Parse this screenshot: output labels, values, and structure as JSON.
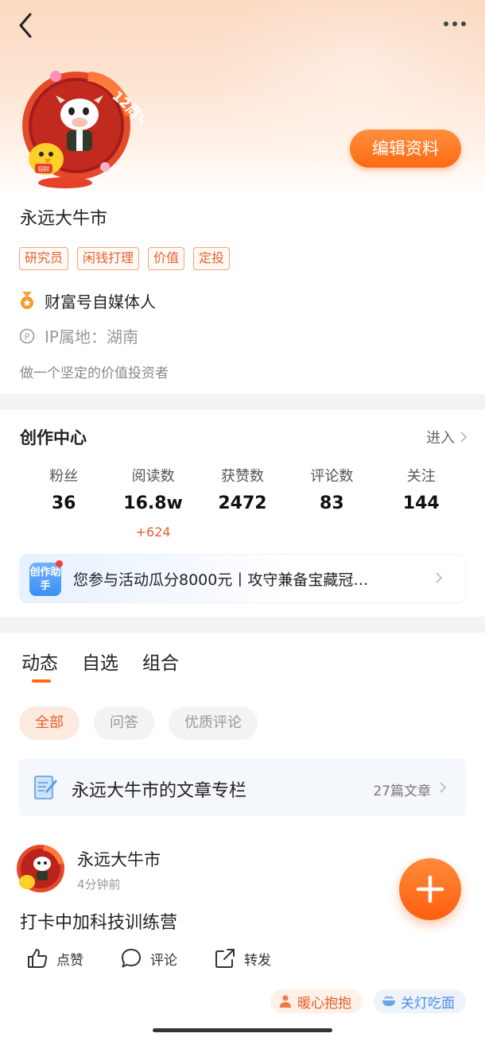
{
  "header": {
    "back_icon": "chevron-left-icon",
    "more_icon": "more-dots-icon"
  },
  "profile": {
    "avatar_badge": "12周年庆",
    "edit_label": "编辑资料",
    "name": "永远大牛市",
    "tags": [
      "研究员",
      "闲钱打理",
      "价值",
      "定投"
    ],
    "badge_text": "财富号自媒体人",
    "ip_text": "IP属地：湖南",
    "bio": "做一个坚定的价值投资者"
  },
  "creator_center": {
    "title": "创作中心",
    "enter_label": "进入",
    "stats": [
      {
        "label": "粉丝",
        "value": "36",
        "delta": ""
      },
      {
        "label": "阅读数",
        "value": "16.8w",
        "delta": "+624"
      },
      {
        "label": "获赞数",
        "value": "2472",
        "delta": ""
      },
      {
        "label": "评论数",
        "value": "83",
        "delta": ""
      },
      {
        "label": "关注",
        "value": "144",
        "delta": ""
      }
    ],
    "banner": {
      "icon_text": "创作助手",
      "text": "您参与活动瓜分8000元丨攻守兼备宝藏冠…"
    }
  },
  "tabs": [
    "动态",
    "自选",
    "组合"
  ],
  "filters": [
    "全部",
    "问答",
    "优质评论"
  ],
  "column": {
    "title": "永远大牛市的文章专栏",
    "count": "27篇文章"
  },
  "post": {
    "author": "永远大牛市",
    "time": "4分钟前",
    "text": "打卡中加科技训练营",
    "actions": [
      "点赞",
      "评论",
      "转发"
    ]
  },
  "chips": [
    "暖心抱抱",
    "关灯吃面"
  ],
  "colors": {
    "accent": "#ff6a12",
    "accent_text": "#e8602a",
    "banner_blue": "#3b8ef5"
  }
}
